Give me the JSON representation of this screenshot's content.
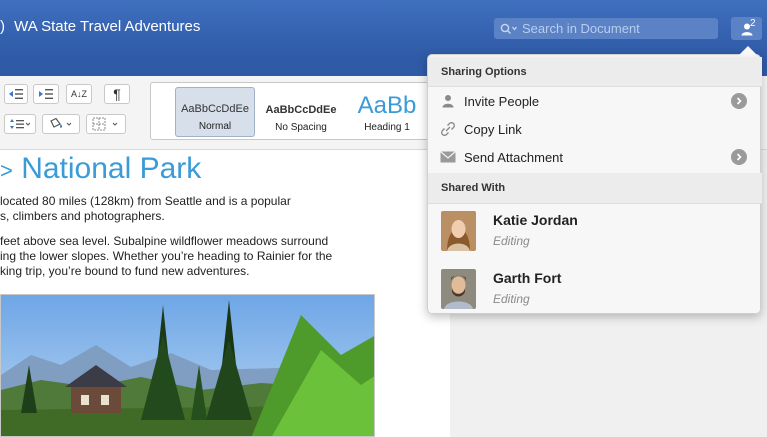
{
  "titlebar": {
    "title": "WA State Travel Adventures",
    "search_placeholder": "Search in Document",
    "share_count": "2",
    "share_icon": "person-icon"
  },
  "ribbon": {
    "pilcrow": "¶",
    "sort_label": "A↓Z",
    "styles": [
      {
        "sample": "AaBbCcDdEe",
        "name": "Normal",
        "selected": true
      },
      {
        "sample": "AaBbCcDdEe",
        "name": "No Spacing",
        "selected": false
      },
      {
        "sample": "AaBb",
        "name": "Heading 1",
        "selected": false
      }
    ]
  },
  "document": {
    "title": "National Park",
    "para1_line1": "located 80 miles (128km) from Seattle and is a popular",
    "para1_line2": "s, climbers and photographers.",
    "para2_line1": "feet above sea level. Subalpine wildflower meadows surround",
    "para2_line2": "ing the lower slopes. Whether you’re heading to Rainier for the",
    "para2_line3": "king trip, you’re bound to fund new adventures."
  },
  "sharing": {
    "options_header": "Sharing Options",
    "items": [
      {
        "label": "Invite People",
        "icon": "invite-people-icon",
        "has_arrow": true
      },
      {
        "label": "Copy Link",
        "icon": "link-icon",
        "has_arrow": false
      },
      {
        "label": "Send Attachment",
        "icon": "envelope-icon",
        "has_arrow": true
      }
    ],
    "shared_header": "Shared With",
    "people": [
      {
        "name": "Katie Jordan",
        "role": "Editing"
      },
      {
        "name": "Garth Fort",
        "role": "Editing"
      }
    ]
  },
  "colors": {
    "titlebar": "#2f5aa6",
    "heading": "#3a9bd8"
  }
}
